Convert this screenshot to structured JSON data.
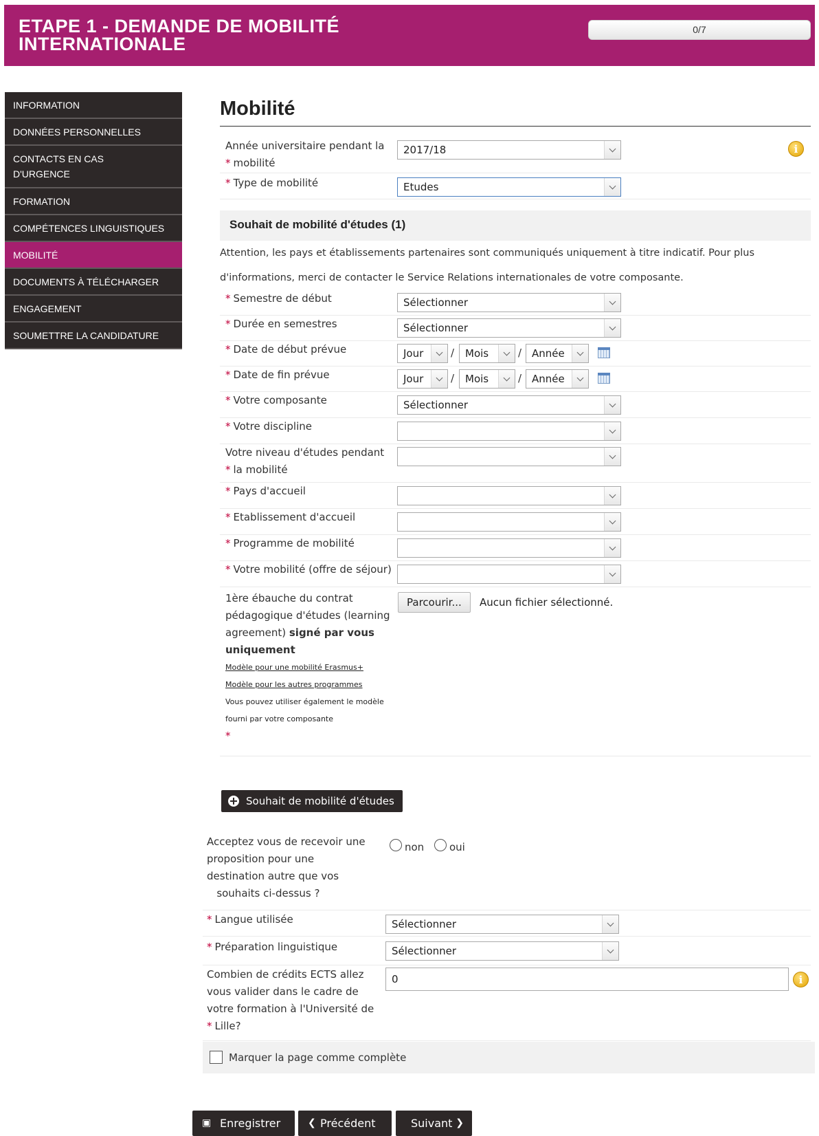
{
  "header": {
    "title_line1": "ETAPE 1 - DEMANDE DE MOBILITÉ",
    "title_line2": "INTERNATIONALE",
    "progress_text": "0/7",
    "progress_value": 0
  },
  "sidebar": {
    "items": [
      {
        "label": "INFORMATION"
      },
      {
        "label": "DONNÉES PERSONNELLES"
      },
      {
        "label_line1": "CONTACTS EN CAS",
        "label_line2": "D'URGENCE"
      },
      {
        "label": "FORMATION"
      },
      {
        "label": "COMPÉTENCES LINGUISTIQUES"
      },
      {
        "label": "MOBILITÉ"
      },
      {
        "label": "DOCUMENTS À TÉLÉCHARGER"
      },
      {
        "label": "ENGAGEMENT"
      },
      {
        "label": "SOUMETTRE LA CANDIDATURE"
      }
    ],
    "active_index": 5
  },
  "main": {
    "title": "Mobilité",
    "required_marker": "*",
    "annee": {
      "label_line1": "Année universitaire pendant la",
      "label_line2": "mobilité",
      "value": "2017/18"
    },
    "type": {
      "label": "Type de mobilité",
      "value": "Etudes"
    },
    "section_title": "Souhait de mobilité d'études (1)",
    "notice_line1": "Attention, les pays et établissements partenaires sont communiqués uniquement à titre indicatif. Pour plus",
    "notice_line2": "d'informations, merci de contacter le Service Relations internationales de votre composante.",
    "semestre": {
      "label": "Semestre de début",
      "value": "Sélectionner"
    },
    "duree": {
      "label": "Durée en semestres",
      "value": "Sélectionner"
    },
    "date_debut": {
      "label": "Date de début prévue",
      "jour": "Jour",
      "mois": "Mois",
      "annee": "Année",
      "sep": "/"
    },
    "date_fin": {
      "label": "Date de fin prévue",
      "jour": "Jour",
      "mois": "Mois",
      "annee": "Année",
      "sep": "/"
    },
    "composante": {
      "label": "Votre composante",
      "value": "Sélectionner"
    },
    "discipline": {
      "label": "Votre discipline",
      "value": ""
    },
    "niveau": {
      "label_line1": "Votre niveau d'études pendant",
      "label_line2": "la mobilité",
      "value": ""
    },
    "pays": {
      "label": "Pays d'accueil",
      "value": ""
    },
    "etablissement": {
      "label": "Etablissement d'accueil",
      "value": ""
    },
    "programme": {
      "label": "Programme de mobilité",
      "value": ""
    },
    "offre": {
      "label": "Votre mobilité (offre de séjour)",
      "value": ""
    },
    "contrat": {
      "label_line1": "1ère ébauche du contrat",
      "label_line2": "pédagogique d'études (learning",
      "label_line3": "agreement)",
      "label_bold1": "signé par vous",
      "label_bold2": "uniquement",
      "link1": "Modèle pour une mobilité Erasmus+",
      "link2": "Modèle pour les autres programmes",
      "note_line1": "Vous pouvez utiliser également le modèle",
      "note_line2": "fourni par votre composante",
      "browse_label": "Parcourir...",
      "file_status": "Aucun fichier sélectionné."
    },
    "add_button": "Souhait de mobilité d'études"
  },
  "extra": {
    "accept": {
      "label_line1": "Acceptez vous de recevoir une",
      "label_line2": "proposition pour une",
      "label_line3": "destination autre que vos",
      "label_line4": "souhaits ci-dessus ?",
      "option_non": "non",
      "option_oui": "oui"
    },
    "langue": {
      "label": "Langue utilisée",
      "value": "Sélectionner"
    },
    "preparation": {
      "label": "Préparation linguistique",
      "value": "Sélectionner"
    },
    "credits": {
      "label_line1": "Combien de crédits ECTS allez",
      "label_line2": "vous valider dans le cadre de",
      "label_line3": "votre formation à l'Université de",
      "label_line4": "Lille?",
      "value": "0"
    },
    "complete_label": "Marquer la page comme complète"
  },
  "footer": {
    "save_label": "Enregistrer",
    "prev_label": "Précédent",
    "next_label": "Suivant"
  }
}
